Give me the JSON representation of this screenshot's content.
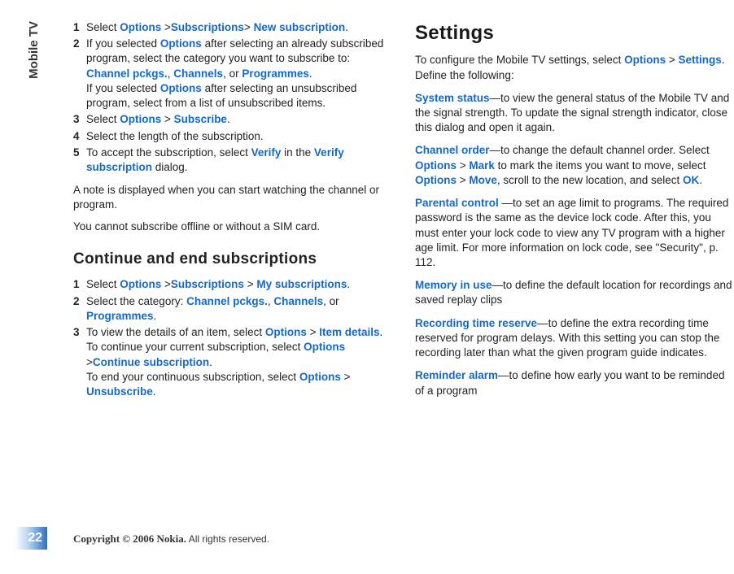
{
  "side_tab": "Mobile TV",
  "page_number": "22",
  "copyright_strong": "Copyright © 2006 Nokia.",
  "copyright_rest": " All rights reserved.",
  "col1": {
    "steps1": [
      {
        "n": "1",
        "parts": [
          "Select ",
          "Options",
          " >",
          "Subscriptions",
          "> ",
          "New subscription",
          "."
        ]
      },
      {
        "n": "2",
        "parts": [
          "If you selected ",
          "Options",
          " after selecting an already subscribed program, select the category you want to subscribe to: ",
          "Channel pckgs.",
          ", ",
          "Channels",
          ", or ",
          "Programmes",
          "."
        ],
        "parts2": [
          "If you selected ",
          "Options",
          " after selecting an unsubscribed program, select from a list of unsubscribed items."
        ]
      },
      {
        "n": "3",
        "parts": [
          "Select ",
          "Options",
          " > ",
          "Subscribe",
          "."
        ]
      },
      {
        "n": "4",
        "parts": [
          "Select the length of the subscription."
        ]
      },
      {
        "n": "5",
        "parts": [
          "To accept the subscription, select ",
          "Verify",
          " in the ",
          "Verify subscription",
          " dialog."
        ]
      }
    ],
    "para1": "A note is displayed when you can start watching the channel or program.",
    "para2": "You cannot subscribe offline or without a SIM card.",
    "subhead": "Continue and end subscriptions",
    "steps2": [
      {
        "n": "1",
        "parts": [
          "Select ",
          "Options",
          " >",
          "Subscriptions",
          " > ",
          "My subscriptions",
          "."
        ]
      },
      {
        "n": "2",
        "parts": [
          "Select the category: ",
          "Channel pckgs.",
          ", ",
          "Channels",
          ", or ",
          "Programmes",
          "."
        ]
      },
      {
        "n": "3",
        "parts": [
          "To view the details of an item, select ",
          "Options",
          " > ",
          "Item details",
          "."
        ],
        "parts2": [
          "To continue your current subscription, select ",
          "Options",
          " >",
          "Continue subscription",
          "."
        ],
        "parts3": [
          "To end your continuous subscription, select ",
          "Options",
          " > ",
          "Unsubscribe",
          "."
        ]
      }
    ]
  },
  "col2": {
    "section": "Settings",
    "intro": [
      "To configure the Mobile TV settings, select ",
      "Options",
      " > ",
      "Settings",
      ". Define the following:"
    ],
    "items": [
      {
        "name": "System status",
        "rest": [
          "—to view the general status of the Mobile TV and the signal strength. To update the signal strength indicator, close this dialog and open it again."
        ]
      },
      {
        "name": "Channel order",
        "rest": [
          "—to change the default channel order. Select ",
          "Options",
          " > ",
          "Mark",
          " to mark the items you want to move, select ",
          "Options",
          " > ",
          "Move",
          ", scroll to the new location, and select ",
          "OK",
          "."
        ]
      },
      {
        "name": "Parental control ",
        "rest": [
          "—to set an age limit to programs. The required password is the same as the device lock code. After this, you must enter your lock code to view any TV program with a higher age limit. For more information on lock code, see \"Security\", p. 112."
        ]
      },
      {
        "name": "Memory in use",
        "rest": [
          "—to define the default location for recordings and saved replay clips"
        ]
      },
      {
        "name": "Recording time reserve",
        "rest": [
          "—to define the extra recording time reserved for program delays. With this setting you can stop the recording later than what the given program guide indicates."
        ]
      },
      {
        "name": "Reminder alarm",
        "rest": [
          "—to define how early you want to be reminded of a program"
        ]
      }
    ]
  }
}
